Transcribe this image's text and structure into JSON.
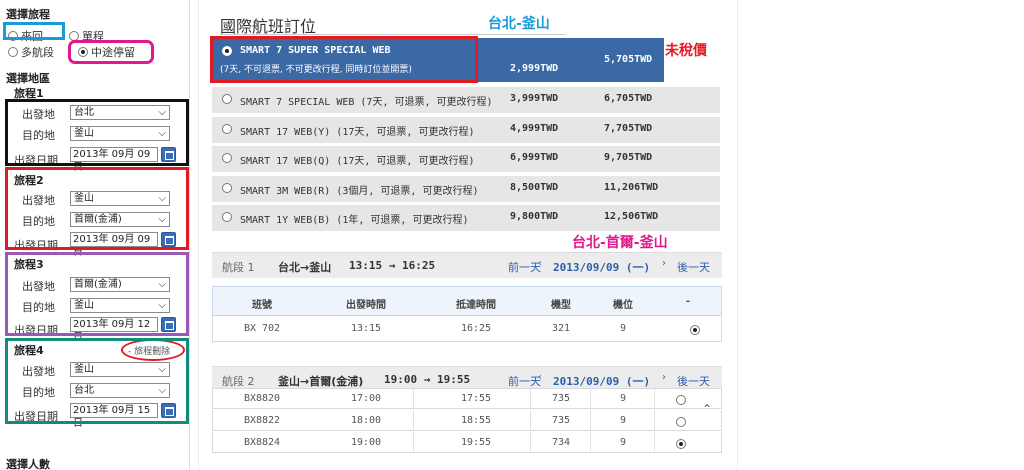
{
  "sidebar": {
    "section_trip": "選擇旅程",
    "trip_options": [
      {
        "label": "來回",
        "selected": false
      },
      {
        "label": "單程",
        "selected": false
      },
      {
        "label": "多航段",
        "selected": false
      },
      {
        "label": "中途停留",
        "selected": true
      }
    ],
    "section_region": "選擇地區",
    "labels": {
      "origin": "出發地",
      "destination": "目的地",
      "date": "出發日期"
    },
    "legs": [
      {
        "title": "旅程1",
        "origin": "台北",
        "destination": "釜山",
        "date": "2013年 09月 09日"
      },
      {
        "title": "旅程2",
        "origin": "釜山",
        "destination": "首爾(金浦)",
        "date": "2013年 09月 09日"
      },
      {
        "title": "旅程3",
        "origin": "首爾(金浦)",
        "destination": "釜山",
        "date": "2013年 09月 12日"
      },
      {
        "title": "旅程4",
        "origin": "釜山",
        "destination": "台北",
        "date": "2013年 09月 15日",
        "delete_label": "- 旅程刪除"
      }
    ],
    "section_passengers": "選擇人數"
  },
  "main": {
    "title": "國際航班訂位",
    "fares": [
      {
        "line1": "SMART 7 SUPER SPECIAL WEB",
        "line2": "(7天, 不可退票, 不可更改行程, 同時訂位並開票)",
        "price1": "2,999TWD",
        "price2": "5,705TWD",
        "selected": true
      },
      {
        "name": "SMART 7 SPECIAL WEB (7天, 可退票, 可更改行程)",
        "price1": "3,999TWD",
        "price2": "6,705TWD",
        "selected": false
      },
      {
        "name": "SMART 17 WEB(Y) (17天, 可退票, 可更改行程)",
        "price1": "4,999TWD",
        "price2": "7,705TWD",
        "selected": false
      },
      {
        "name": "SMART 17 WEB(Q) (17天, 可退票, 可更改行程)",
        "price1": "6,999TWD",
        "price2": "9,705TWD",
        "selected": false
      },
      {
        "name": "SMART 3M WEB(R) (3個月, 可退票, 可更改行程)",
        "price1": "8,500TWD",
        "price2": "11,206TWD",
        "selected": false
      },
      {
        "name": "SMART 1Y WEB(B) (1年, 可退票, 可更改行程)",
        "price1": "9,800TWD",
        "price2": "12,506TWD",
        "selected": false
      }
    ],
    "segment1": {
      "label": "航段 1",
      "route": "台北→釜山",
      "time": "13:15 → 16:25",
      "prev": "前一天",
      "date": "2013/09/09 (一)",
      "next": "後一天"
    },
    "table_headers": [
      "班號",
      "出發時間",
      "抵達時間",
      "機型",
      "機位",
      "-"
    ],
    "segment1_rows": [
      {
        "flight": "BX 702",
        "dep": "13:15",
        "arr": "16:25",
        "type": "321",
        "seats": "9",
        "selected": true
      }
    ],
    "segment2": {
      "label": "航段 2",
      "route": "釜山→首爾(金浦)",
      "time": "19:00 → 19:55",
      "prev": "前一天",
      "date": "2013/09/09 (一)",
      "next": "後一天"
    },
    "segment2_rows": [
      {
        "flight": "BX8820",
        "dep": "17:00",
        "arr": "17:55",
        "type": "735",
        "seats": "9",
        "selected": false
      },
      {
        "flight": "BX8822",
        "dep": "18:00",
        "arr": "18:55",
        "type": "735",
        "seats": "9",
        "selected": false
      },
      {
        "flight": "BX8824",
        "dep": "19:00",
        "arr": "19:55",
        "type": "734",
        "seats": "9",
        "selected": true
      }
    ]
  },
  "annotations": {
    "route1": "台北-釜山",
    "pretax": "未稅價",
    "route2": "台北-首爾-釜山"
  },
  "colors": {
    "blue_box": "#1a9ad6",
    "pink_box": "#e0198c",
    "black_box": "#111111",
    "red_box": "#e01b24",
    "purple_box": "#9b59b6",
    "teal_box": "#138a7e",
    "selected_fare": "#3a69a6",
    "link": "#2a5fb0"
  }
}
